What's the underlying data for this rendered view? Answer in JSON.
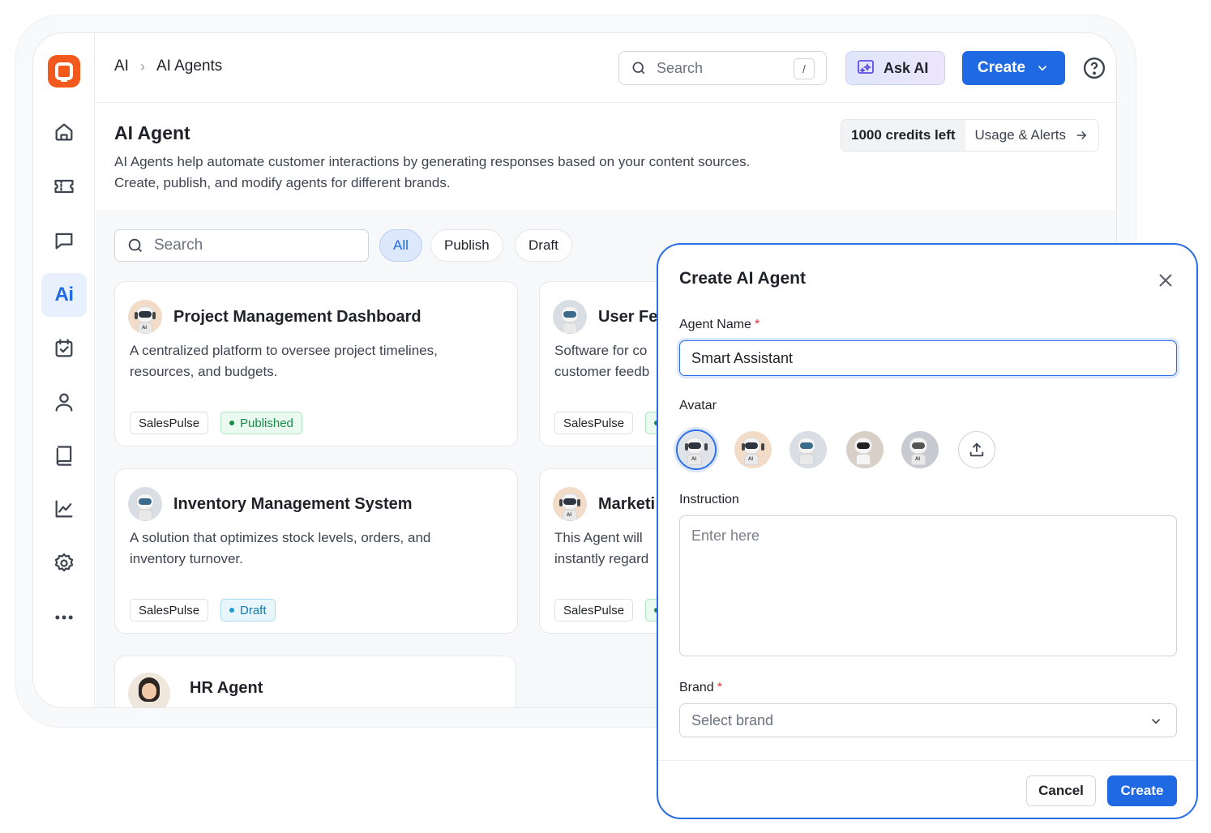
{
  "header": {
    "breadcrumb": [
      "AI",
      "AI Agents"
    ],
    "search_placeholder": "Search",
    "search_shortcut": "/",
    "ask_ai_label": "Ask AI",
    "create_label": "Create"
  },
  "page": {
    "title": "AI Agent",
    "description": "AI Agents help automate customer interactions by generating responses based on your content sources. Create, publish, and modify agents for different brands.",
    "credits": "1000 credits left",
    "usage_link": "Usage & Alerts"
  },
  "filters": {
    "search_placeholder": "Search",
    "chips": [
      "All",
      "Publish",
      "Draft"
    ],
    "active": "All"
  },
  "cards": [
    {
      "title": "Project Management Dashboard",
      "description": "A centralized platform to oversee project timelines, resources, and budgets.",
      "brand": "SalesPulse",
      "status": "Published"
    },
    {
      "title": "User Fe",
      "description": "Software for co customer feedb",
      "brand": "SalesPulse",
      "status": ""
    },
    {
      "title": "Inventory Management System",
      "description": "A solution that optimizes stock levels, orders, and inventory turnover.",
      "brand": "SalesPulse",
      "status": "Draft"
    },
    {
      "title": "Marketi",
      "description": "This Agent will instantly regard",
      "brand": "SalesPulse",
      "status": ""
    },
    {
      "title": "HR Agent",
      "description": "",
      "brand": "",
      "status": ""
    }
  ],
  "modal": {
    "title": "Create AI Agent",
    "agent_name_label": "Agent Name",
    "agent_name_value": "Smart Assistant",
    "avatar_label": "Avatar",
    "instruction_label": "Instruction",
    "instruction_placeholder": "Enter here",
    "brand_label": "Brand",
    "brand_placeholder": "Select brand",
    "required_mark": "*",
    "cancel_label": "Cancel",
    "create_label": "Create"
  },
  "colors": {
    "accent": "#1f6ae3",
    "brand_logo": "#f25a1d",
    "published": "#1a8a4a",
    "draft": "#1377a8"
  }
}
